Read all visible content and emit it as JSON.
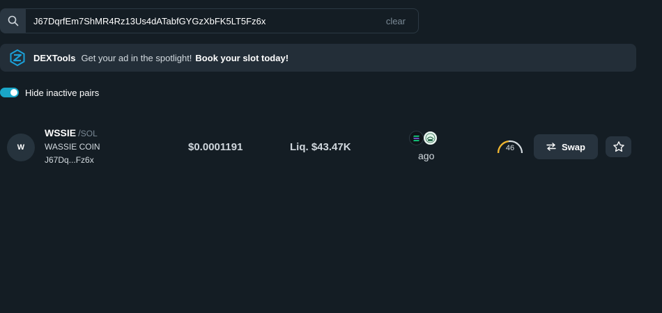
{
  "search": {
    "value": "J67DqrfEm7ShMR4Rz13Us4dATabfGYGzXbFK5LT5Fz6x",
    "clear_label": "clear"
  },
  "banner": {
    "brand": "DEXTools",
    "message": "Get your ad in the spotlight!",
    "cta": "Book your slot today!"
  },
  "filters": {
    "hide_inactive_label": "Hide inactive pairs",
    "hide_inactive_on": true
  },
  "pair": {
    "avatar_letter": "W",
    "base_symbol": "WSSIE",
    "separator": "/",
    "quote_symbol": "SOL",
    "token_name": "WASSIE COIN",
    "address_short": "J67Dq...Fz6x",
    "price": "$0.0001191",
    "liquidity": "Liq. $43.47K",
    "age_label": "ago",
    "score": "46",
    "score_fraction": 0.46,
    "swap_label": "Swap",
    "chain_icon": "solana-icon",
    "dex_icon": "dex-exchange-icon"
  },
  "colors": {
    "background": "#141d24",
    "panel": "#232e38",
    "accent": "#1aa6c8",
    "score_arc": "#f0b429"
  }
}
